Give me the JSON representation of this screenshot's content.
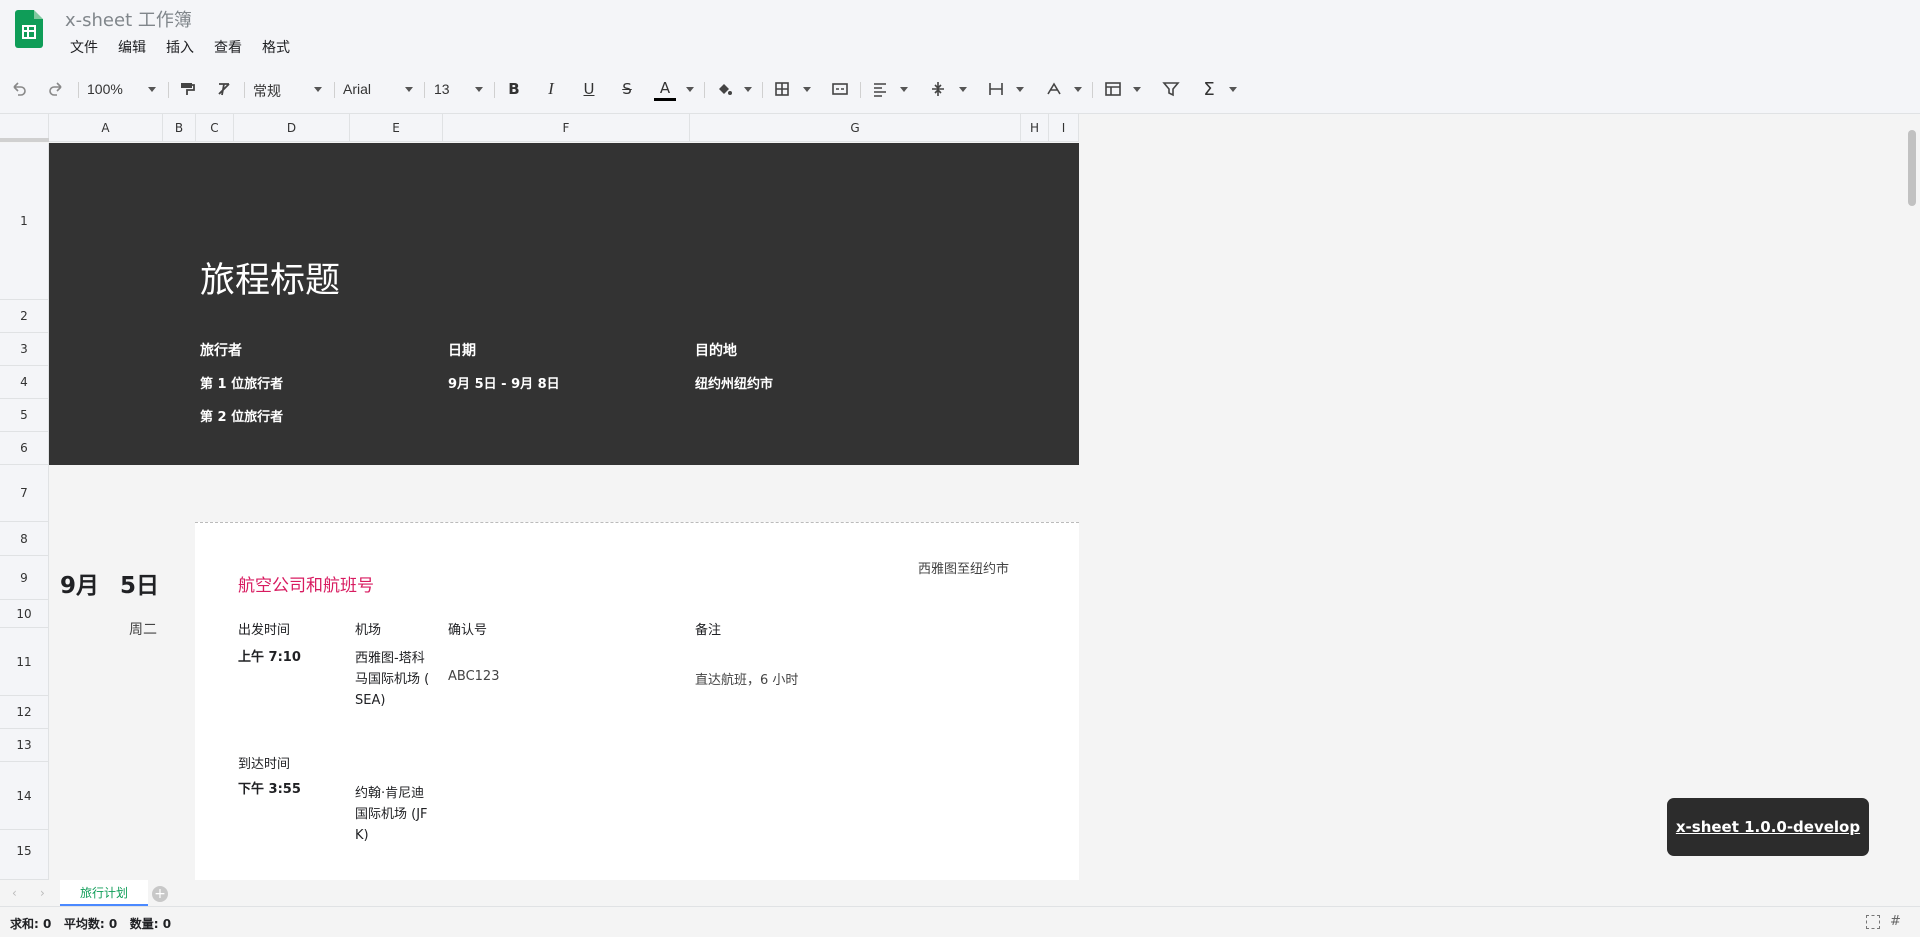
{
  "app": {
    "title": "x-sheet 工作簿"
  },
  "menu": [
    "文件",
    "编辑",
    "插入",
    "查看",
    "格式"
  ],
  "toolbar": {
    "zoom": "100%",
    "format": "常规",
    "font": "Arial",
    "font_size": "13"
  },
  "columns": [
    "A",
    "B",
    "C",
    "D",
    "E",
    "F",
    "G",
    "H",
    "I"
  ],
  "rows": [
    "1",
    "2",
    "3",
    "4",
    "5",
    "6",
    "7",
    "8",
    "9",
    "10",
    "11",
    "12",
    "13",
    "14",
    "15"
  ],
  "banner": {
    "title": "旅程标题",
    "traveler_label": "旅行者",
    "date_label": "日期",
    "dest_label": "目的地",
    "traveler1": "第 1 位旅行者",
    "traveler2": "第 2 位旅行者",
    "dates": "9月 5日 - 9月 8日",
    "destination": "纽约州纽约市"
  },
  "day": {
    "month": "9月",
    "day": "5日",
    "weekday": "周二"
  },
  "flight": {
    "heading": "航空公司和航班号",
    "route": "西雅图至纽约市",
    "depart_label": "出发时间",
    "airport_label": "机场",
    "confirm_label": "确认号",
    "notes_label": "备注",
    "depart_time": "上午 7:10",
    "depart_airport_1": "西雅图-塔科",
    "depart_airport_2": "马国际机场 (",
    "depart_airport_3": "SEA)",
    "confirmation": "ABC123",
    "notes": "直达航班，6 小时",
    "arrive_label": "到达时间",
    "arrive_time": "下午 3:55",
    "arrive_airport_1": "约翰·肯尼迪",
    "arrive_airport_2": "国际机场 (JF",
    "arrive_airport_3": "K)"
  },
  "sheets": [
    "旅行计划"
  ],
  "status": {
    "sum": "求和: 0",
    "avg": "平均数: 0",
    "count": "数量: 0"
  },
  "version": "x-sheet 1.0.0-develop",
  "colors": {
    "banner": "#333333",
    "heading": "#d81b60",
    "logo": "#0f9d58"
  }
}
